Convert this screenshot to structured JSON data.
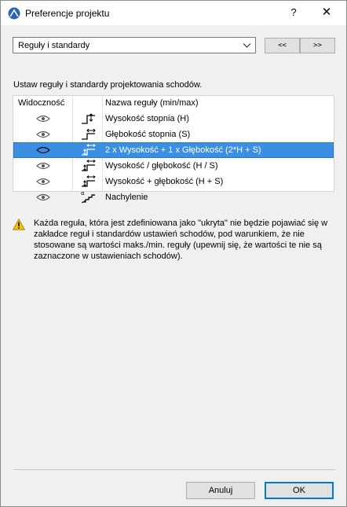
{
  "window": {
    "title": "Preferencje projektu",
    "help_label": "?",
    "close_label": "✕"
  },
  "dropdown": {
    "value": "Reguły i standardy"
  },
  "nav": {
    "prev_label": "<<",
    "next_label": ">>"
  },
  "section_label": "Ustaw reguły i standardy projektowania schodów.",
  "table": {
    "headers": {
      "visibility": "Widoczność",
      "name": "Nazwa reguły (min/max)"
    },
    "rows": [
      {
        "name": "Wysokość stopnia (H)",
        "icon": "riser-height-icon",
        "selected": false
      },
      {
        "name": "Głębokość stopnia (S)",
        "icon": "tread-depth-icon",
        "selected": false
      },
      {
        "name": "2 x Wysokość + 1 x Głębokość (2*H + S)",
        "icon": "riser-tread-formula-icon",
        "selected": true
      },
      {
        "name": "Wysokość / głębokość (H / S)",
        "icon": "riser-tread-ratio-icon",
        "selected": false
      },
      {
        "name": "Wysokość + głębokość (H + S)",
        "icon": "riser-tread-sum-icon",
        "selected": false
      },
      {
        "name": "Nachylenie",
        "icon": "slope-angle-icon",
        "selected": false
      }
    ]
  },
  "warning": {
    "icon": "warning-icon",
    "text": "Każda reguła, która jest zdefiniowana jako \"ukryta\" nie będzie pojawiać się w zakładce reguł i standardów ustawień schodów, pod warunkiem, że nie stosowane są wartości maks./min. reguły (upewnij się, że wartości te nie są zaznaczone w ustawieniach schodów)."
  },
  "buttons": {
    "cancel": "Anuluj",
    "ok": "OK"
  },
  "colors": {
    "selection": "#3b8fe2",
    "default_button_border": "#0078d7",
    "warning": "#f5c400"
  }
}
